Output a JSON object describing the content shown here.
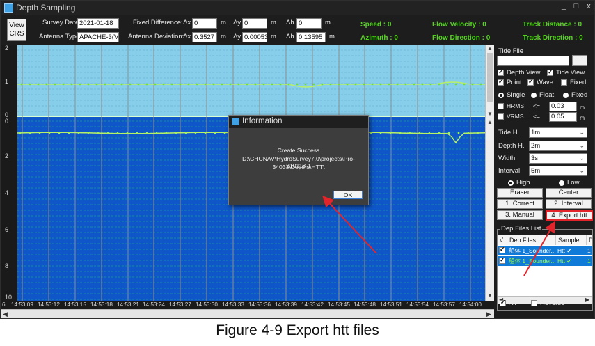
{
  "window": {
    "title": "Depth Sampling",
    "controls": {
      "minimize": "_",
      "maximize": "□",
      "close": "x"
    }
  },
  "header": {
    "view_crs": "View CRS",
    "survey_date_label": "Survey Date",
    "survey_date": "2021-01-18",
    "antenna_type_label": "Antenna Type",
    "antenna_type": "APACHE-3(V1.1)",
    "fixed_difference_label": "Fixed Difference:",
    "antenna_deviation_label": "Antenna Deviation:",
    "dx_label": "Δx",
    "dy_label": "Δy",
    "dh_label": "Δh",
    "unit_m": "m",
    "fixed_dx": "0",
    "fixed_dy": "0",
    "fixed_dh": "0",
    "dev_dx": "0.3527",
    "dev_dy": "0.000535",
    "dev_dh": "0.13595",
    "speed": "Speed :  0",
    "azimuth": "Azimuth : 0",
    "flow_velocity": "Flow Velocity :  0",
    "flow_direction": "Flow Direction :  0",
    "track_distance": "Track Distance :  0",
    "track_direction": "Track Direction :  0"
  },
  "plot": {
    "tide_ticks": [
      "2",
      "1",
      "0"
    ],
    "depth_ticks": [
      "0",
      "2",
      "4",
      "6",
      "8",
      "10"
    ],
    "x_ticks": [
      "14:53:09",
      "14:53:12",
      "14:53:15",
      "14:53:18",
      "14:53:21",
      "14:53:24",
      "14:53:27",
      "14:53:30",
      "14:53:33",
      "14:53:36",
      "14:53:39",
      "14:53:42",
      "14:53:45",
      "14:53:48",
      "14:53:51",
      "14:53:54",
      "14:53:57",
      "14:54:00"
    ],
    "x_first_prefix": "6",
    "colors": {
      "tide_bg": "#87ceeb",
      "depth_bg": "#0f56c9",
      "trace": "#b9f06a",
      "grid": "#2bd96e"
    }
  },
  "panel": {
    "tide_file_label": "Tide File",
    "tide_file_value": "",
    "browse": "...",
    "depth_view": "Depth View",
    "tide_view": "Tide View",
    "point": "Point",
    "wave": "Wave",
    "fixed_chk": "Fixed",
    "single": "Single",
    "float": "Float",
    "fixed_radio": "Fixed",
    "hrms": "HRMS",
    "vrms": "VRMS",
    "hrms_op": "<=",
    "vrms_op": "<=",
    "hrms_value": "0.03",
    "vrms_value": "0.05",
    "unit_m": "m",
    "tide_h_label": "Tide H.",
    "tide_h_value": "1m",
    "depth_h_label": "Depth H.",
    "depth_h_value": "2m",
    "width_label": "Width",
    "width_value": "3s",
    "interval_label": "Interval",
    "interval_value": "5m",
    "high": "High",
    "low": "Low",
    "eraser": "Eraser",
    "center": "Center",
    "correct": "1. Correct",
    "interval_btn": "2. Interval",
    "manual": "3. Manual",
    "export_htt": "4. Export htt",
    "dep_files_list": "Dep Files List",
    "col_check": "√",
    "col_dep_files": "Dep Files",
    "col_sample": "Sample",
    "col_extra": "D",
    "rows": [
      {
        "file": "船体 1_Sounder...",
        "sample": "Htt ✔",
        "extra": "1"
      },
      {
        "file": "船体 1_Sounder...",
        "sample": "Htt ✔",
        "extra": "1"
      }
    ],
    "all": "All",
    "reverse": "Reverse"
  },
  "dialog": {
    "title": "Information",
    "message_line1": "Create Success",
    "message_line2": "D:\\CHCNAV\\HydroSurvey7.0\\projects\\Pro-210118-1",
    "message_line3": "34033\\Depths\\HTT\\",
    "ok": "OK"
  },
  "caption": "Figure 4-9 Export htt files"
}
